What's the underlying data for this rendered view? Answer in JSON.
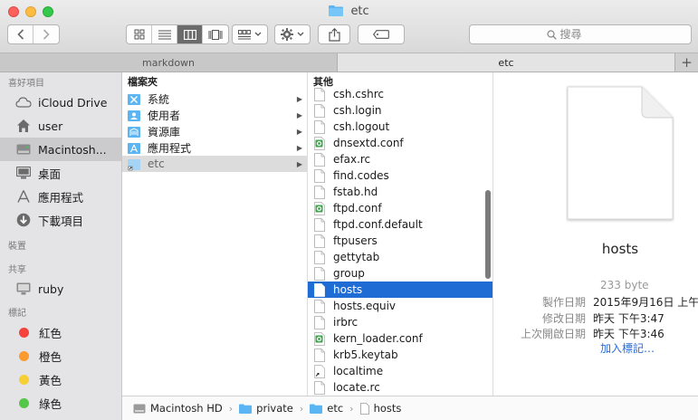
{
  "window": {
    "title": "etc"
  },
  "toolbar": {
    "search_placeholder": "搜尋"
  },
  "tabs": [
    {
      "label": "markdown"
    },
    {
      "label": "etc"
    }
  ],
  "tab_add": "+",
  "sidebar": {
    "favorites_header": "喜好項目",
    "favorites": [
      {
        "label": "iCloud Drive",
        "icon": "cloud-icon"
      },
      {
        "label": "user",
        "icon": "home-icon"
      },
      {
        "label": "Macintosh...",
        "icon": "harddisk-icon"
      },
      {
        "label": "桌面",
        "icon": "desktop-icon"
      },
      {
        "label": "應用程式",
        "icon": "applications-icon"
      },
      {
        "label": "下載項目",
        "icon": "download-icon"
      }
    ],
    "devices_header": "裝置",
    "shared_header": "共享",
    "shared": [
      {
        "label": "ruby",
        "icon": "display-icon"
      }
    ],
    "tags_header": "標記",
    "tags": [
      {
        "label": "紅色",
        "color": "#f5423b"
      },
      {
        "label": "橙色",
        "color": "#fa9a2f"
      },
      {
        "label": "黃色",
        "color": "#f7cf35"
      },
      {
        "label": "綠色",
        "color": "#55c748"
      }
    ]
  },
  "column1": {
    "header": "檔案夾",
    "items": [
      {
        "label": "系統"
      },
      {
        "label": "使用者"
      },
      {
        "label": "資源庫"
      },
      {
        "label": "應用程式"
      },
      {
        "label": "etc"
      }
    ]
  },
  "column2": {
    "header": "其他",
    "items": [
      {
        "label": "csh.cshrc"
      },
      {
        "label": "csh.login"
      },
      {
        "label": "csh.logout"
      },
      {
        "label": "dnsextd.conf"
      },
      {
        "label": "efax.rc"
      },
      {
        "label": "find.codes"
      },
      {
        "label": "fstab.hd"
      },
      {
        "label": "ftpd.conf"
      },
      {
        "label": "ftpd.conf.default"
      },
      {
        "label": "ftpusers"
      },
      {
        "label": "gettytab"
      },
      {
        "label": "group"
      },
      {
        "label": "hosts"
      },
      {
        "label": "hosts.equiv"
      },
      {
        "label": "irbrc"
      },
      {
        "label": "kern_loader.conf"
      },
      {
        "label": "krb5.keytab"
      },
      {
        "label": "localtime"
      },
      {
        "label": "locate.rc"
      }
    ]
  },
  "preview": {
    "name": "hosts",
    "size": "233 byte",
    "created_label": "製作日期",
    "created_value": "2015年9月16日 上午",
    "modified_label": "修改日期",
    "modified_value": "昨天 下午3:47",
    "opened_label": "上次開啟日期",
    "opened_value": "昨天 下午3:46",
    "add_tags": "加入標記…"
  },
  "pathbar": [
    {
      "label": "Macintosh HD"
    },
    {
      "label": "private"
    },
    {
      "label": "etc"
    },
    {
      "label": "hosts"
    }
  ]
}
